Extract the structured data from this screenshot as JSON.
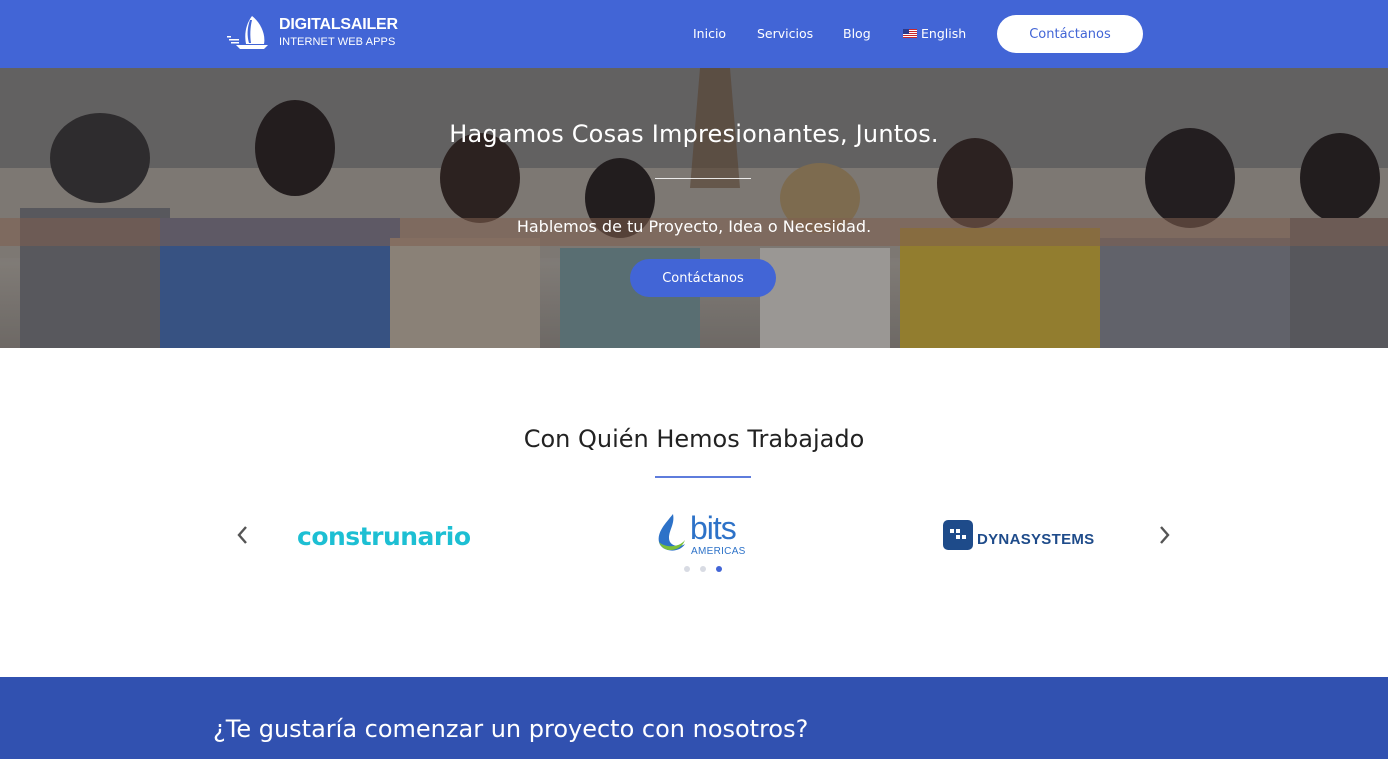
{
  "header": {
    "logo_name": "DIGITALSAILER",
    "logo_tagline": "INTERNET WEB APPS",
    "nav": [
      {
        "label": "Inicio"
      },
      {
        "label": "Servicios"
      },
      {
        "label": "Blog"
      },
      {
        "label": "English",
        "icon": "us-flag-icon"
      }
    ],
    "cta_label": "Contáctanos"
  },
  "hero": {
    "title": "Hagamos Cosas Impresionantes, Juntos.",
    "subtitle": "Hablemos de tu Proyecto, Idea o Necesidad.",
    "cta_label": "Contáctanos"
  },
  "clients": {
    "title": "Con Quién Hemos Trabajado",
    "logos": [
      {
        "name": "construnario",
        "text": "construnario"
      },
      {
        "name": "bits-americas",
        "text": "bits",
        "subtext": "AMERICAS"
      },
      {
        "name": "dynasystems",
        "text": "DYNASYSTEMS"
      }
    ],
    "carousel_dots": 3,
    "active_dot": 3
  },
  "cta_band": {
    "text": "¿Te gustaría comenzar un proyecto con nosotros?"
  },
  "colors": {
    "brand_blue": "#4265d6",
    "band_blue": "#3151b0",
    "construnario_cyan": "#1dbfd3"
  }
}
